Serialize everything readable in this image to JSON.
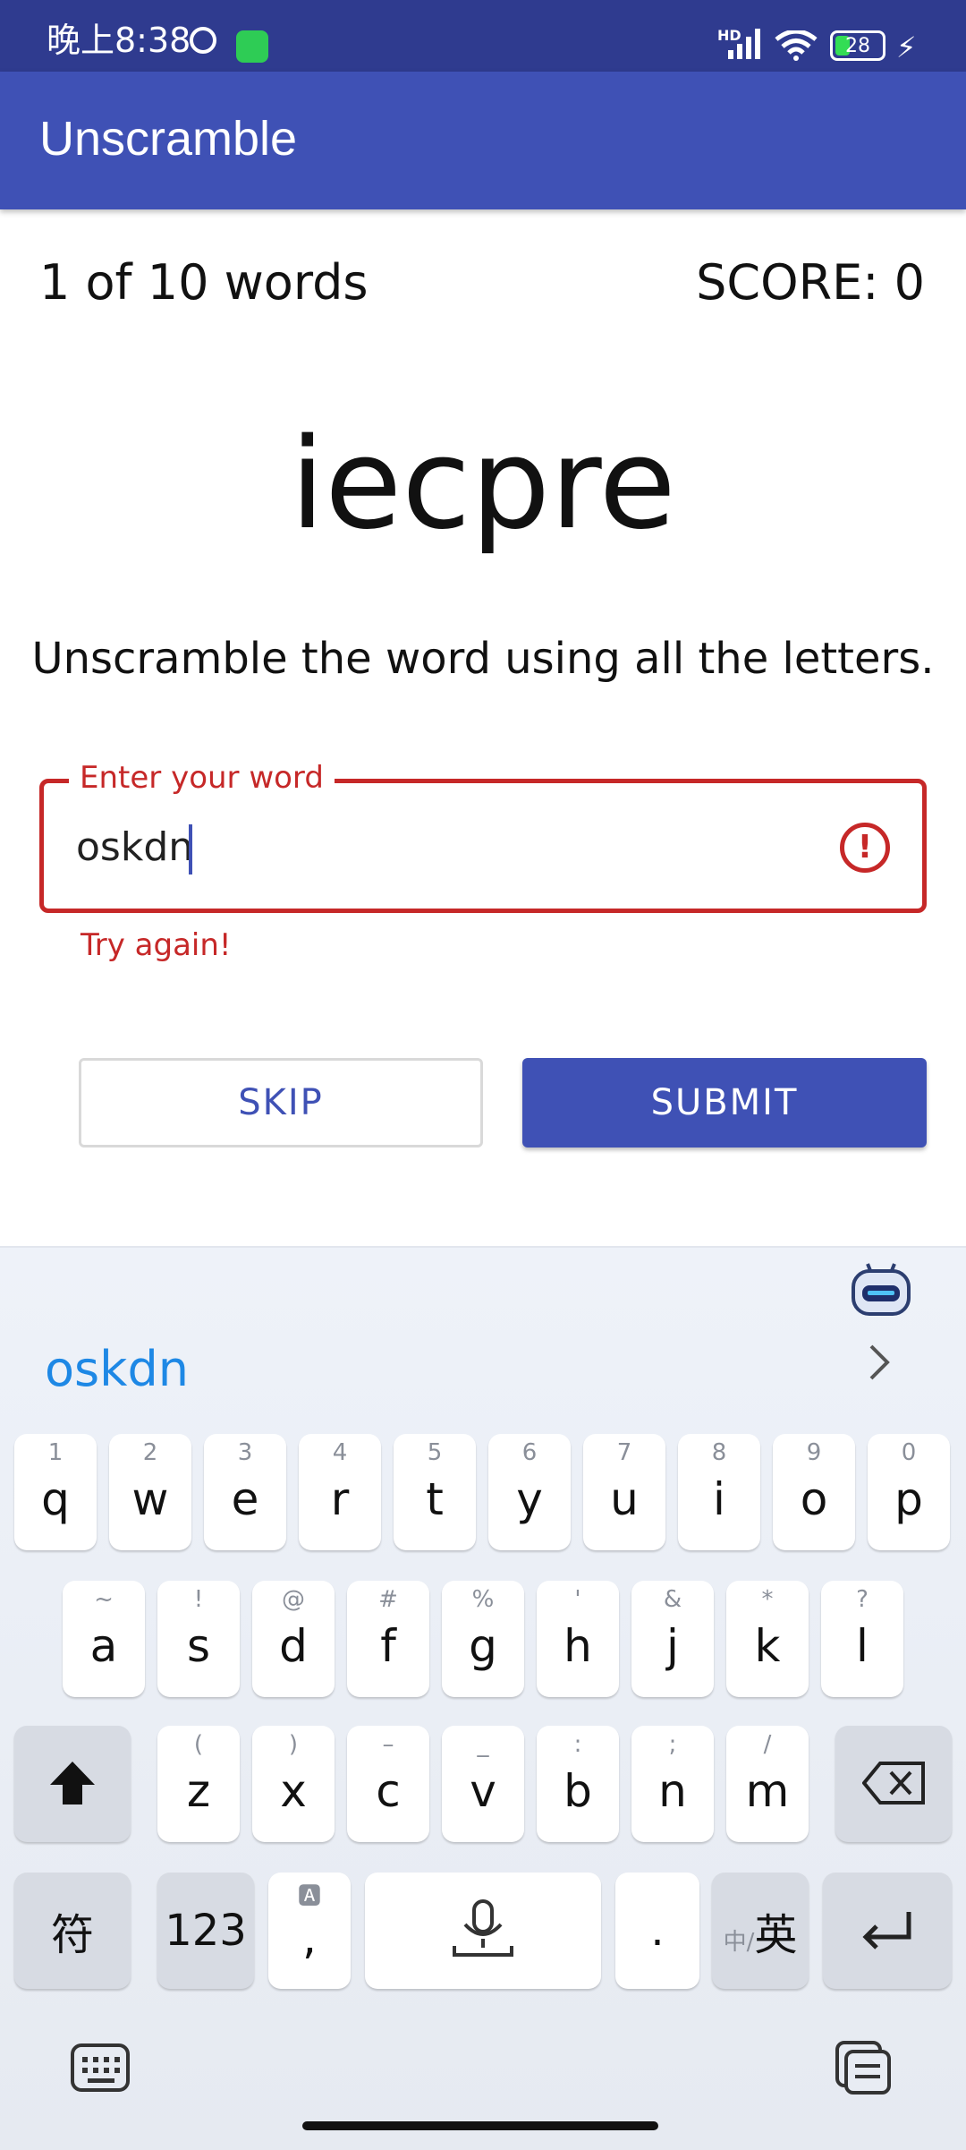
{
  "status_bar": {
    "time": "晚上8:38",
    "battery": "28"
  },
  "app_bar": {
    "title": "Unscramble"
  },
  "game": {
    "word_count": "1 of 10 words",
    "score": "SCORE: 0",
    "scrambled_word": "iecpre",
    "instructions": "Unscramble the word using all the letters."
  },
  "input": {
    "label": "Enter your word",
    "value": "oskdn",
    "error": "Try again!",
    "error_icon": "alert-circle-icon"
  },
  "buttons": {
    "skip": "SKIP",
    "submit": "SUBMIT"
  },
  "colors": {
    "primary": "#3f51b5",
    "status_bar": "#2f3b8f",
    "error": "#c62828",
    "suggestion": "#1e88e5"
  },
  "keyboard": {
    "suggestion": "oskdn",
    "row1": [
      {
        "hint": "1",
        "key": "q"
      },
      {
        "hint": "2",
        "key": "w"
      },
      {
        "hint": "3",
        "key": "e"
      },
      {
        "hint": "4",
        "key": "r"
      },
      {
        "hint": "5",
        "key": "t"
      },
      {
        "hint": "6",
        "key": "y"
      },
      {
        "hint": "7",
        "key": "u"
      },
      {
        "hint": "8",
        "key": "i"
      },
      {
        "hint": "9",
        "key": "o"
      },
      {
        "hint": "0",
        "key": "p"
      }
    ],
    "row2": [
      {
        "hint": "~",
        "key": "a"
      },
      {
        "hint": "!",
        "key": "s"
      },
      {
        "hint": "@",
        "key": "d"
      },
      {
        "hint": "#",
        "key": "f"
      },
      {
        "hint": "%",
        "key": "g"
      },
      {
        "hint": "'",
        "key": "h"
      },
      {
        "hint": "&",
        "key": "j"
      },
      {
        "hint": "*",
        "key": "k"
      },
      {
        "hint": "?",
        "key": "l"
      }
    ],
    "row3": [
      {
        "hint": "(",
        "key": "z"
      },
      {
        "hint": ")",
        "key": "x"
      },
      {
        "hint": "–",
        "key": "c"
      },
      {
        "hint": "_",
        "key": "v"
      },
      {
        "hint": ":",
        "key": "b"
      },
      {
        "hint": ";",
        "key": "n"
      },
      {
        "hint": "/",
        "key": "m"
      }
    ],
    "symbols_key": "符",
    "numbers_key": "123",
    "comma_key": ",",
    "period_key": ".",
    "lang_key_small": "中/",
    "lang_key_big": "英"
  }
}
